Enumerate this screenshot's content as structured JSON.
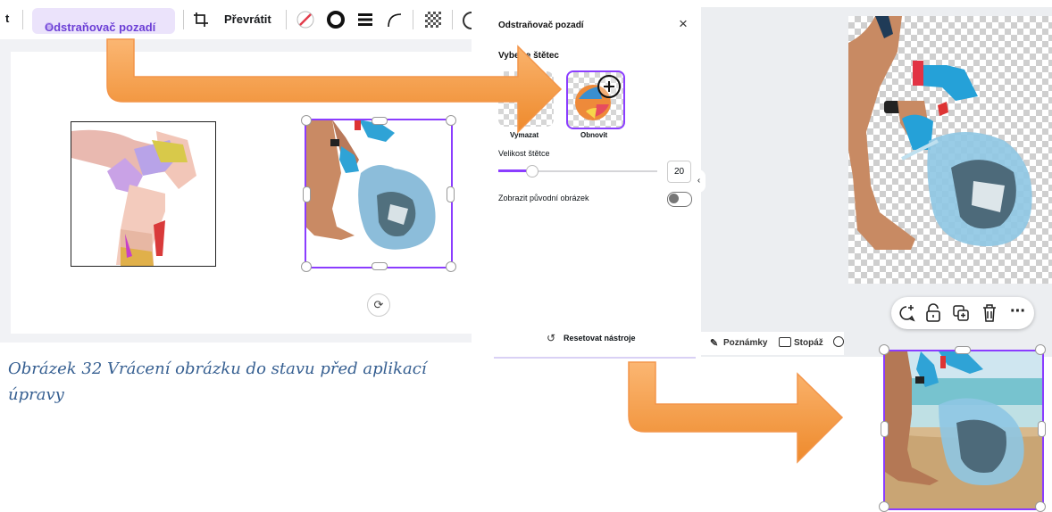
{
  "toolbar": {
    "truncated_label": "t",
    "bg_remover_label": "Odstraňovač pozadí",
    "crown": "♛",
    "flip_label": "Převrátit"
  },
  "caption": "Obrázek 32 Vrácení obrázku do stavu před aplikací úpravy",
  "panel": {
    "title": "Odstraňovač pozadí",
    "brush_heading": "Vyberte štětec",
    "erase_label": "Vymazat",
    "restore_label": "Obnovit",
    "brush_size_label": "Velikost štětce",
    "brush_size_value": "20",
    "brush_size_fraction": 0.2,
    "show_original_label": "Zobrazit původní obrázek",
    "show_original_on": false,
    "reset_label": "Resetovat nástroje"
  },
  "bottom_bar": {
    "notes_label": "Poznámky",
    "footage_label": "Stopáž"
  },
  "colors": {
    "accent": "#8b3dff",
    "arrow": "#f79646",
    "caption": "#365f91"
  },
  "icons": [
    "crop-icon",
    "color-slash-icon",
    "stroke-circle-icon",
    "lines-icon",
    "corner-icon",
    "transparency-icon",
    "close-icon",
    "chevron-left-icon",
    "reset-icon",
    "comment-icon",
    "lock-icon",
    "duplicate-icon",
    "trash-icon",
    "more-icon",
    "rotate-icon"
  ]
}
